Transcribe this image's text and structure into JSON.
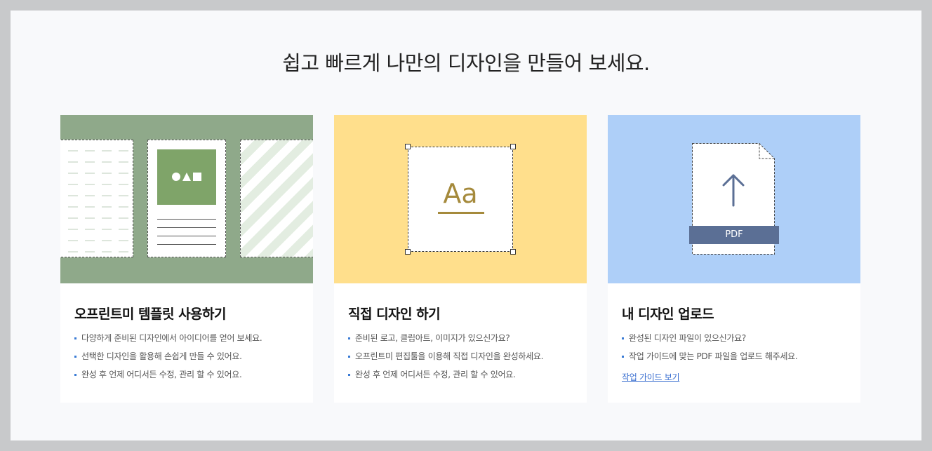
{
  "headline": "쉽고 빠르게 나만의 디자인을 만들어 보세요.",
  "cards": [
    {
      "title": "오프린트미 템플릿 사용하기",
      "bullets": [
        "다양하게 준비된 디자인에서 아이디어를 얻어 보세요.",
        "선택한 디자인을 활용해 손쉽게 만들 수 있어요.",
        "완성 후 언제 어디서든 수정, 관리 할 수 있어요."
      ]
    },
    {
      "title": "직접 디자인 하기",
      "bullets": [
        "준비된 로고, 클립아트, 이미지가 있으신가요?",
        "오프린트미 편집툴을 이용해 직접 디자인을 완성하세요.",
        "완성 후 언제 어디서든 수정, 관리 할 수 있어요."
      ],
      "font_sample": "Aa"
    },
    {
      "title": "내 디자인 업로드",
      "bullets": [
        "완성된 디자인 파일이 있으신가요?",
        "작업 가이드에 맞는 PDF 파일을 업로드 해주세요."
      ],
      "link": "작업 가이드 보기",
      "badge": "PDF"
    }
  ],
  "colors": {
    "template_hero": "#8fa98a",
    "design_hero": "#ffdf8c",
    "upload_hero": "#aecff8",
    "accent_gold": "#a58a3c",
    "pdf_badge": "#5b6f95",
    "link": "#3a6fd0"
  },
  "icons": {
    "template": "template-pages-illustration",
    "design": "text-selection-illustration",
    "upload": "upload-arrow-icon"
  }
}
